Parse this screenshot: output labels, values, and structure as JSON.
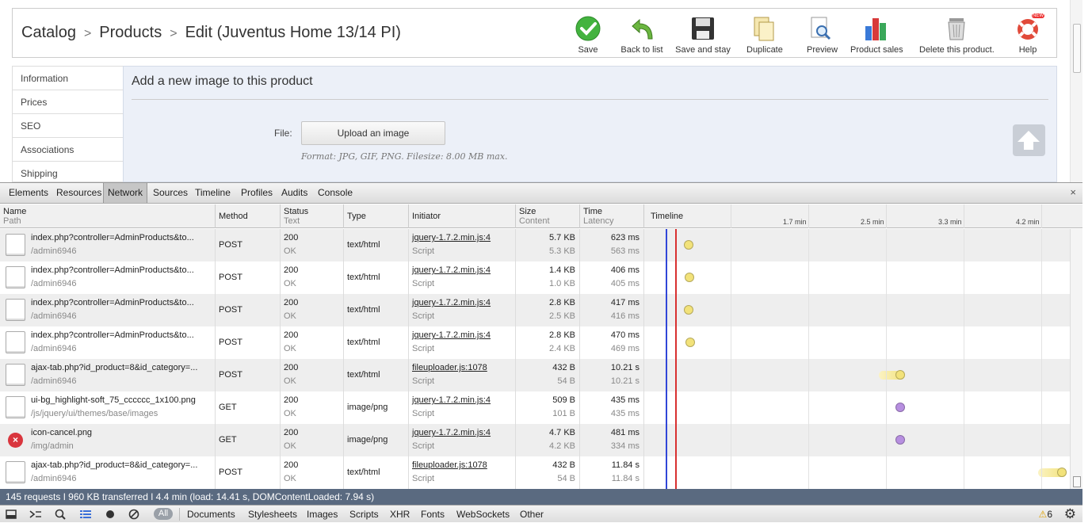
{
  "breadcrumb": {
    "catalog": "Catalog",
    "products": "Products",
    "current": "Edit (Juventus Home 13/14 PI)",
    "separator": ">"
  },
  "toolbar": {
    "save": "Save",
    "back": "Back to list",
    "save_stay": "Save and stay",
    "duplicate": "Duplicate",
    "preview": "Preview",
    "product_sales": "Product sales",
    "delete": "Delete this product.",
    "help": "Help",
    "help_badge": "NEW"
  },
  "sidebar": [
    "Information",
    "Prices",
    "SEO",
    "Associations",
    "Shipping"
  ],
  "content": {
    "title": "Add a new image to this product",
    "file_label": "File:",
    "upload_button": "Upload an image",
    "format_note": "Format: JPG, GIF, PNG. Filesize: 8.00 MB max."
  },
  "devtools": {
    "tabs": [
      "Elements",
      "Resources",
      "Network",
      "Sources",
      "Timeline",
      "Profiles",
      "Audits",
      "Console"
    ],
    "active_tab": "Network",
    "close": "×",
    "columns": {
      "name": "Name",
      "path": "Path",
      "method": "Method",
      "status": "Status",
      "text": "Text",
      "type": "Type",
      "initiator": "Initiator",
      "size": "Size",
      "content": "Content",
      "time": "Time",
      "latency": "Latency",
      "timeline": "Timeline"
    },
    "timeline_ticks": [
      "1.7 min",
      "2.5 min",
      "3.3 min",
      "4.2 min"
    ],
    "rows": [
      {
        "name": "index.php?controller=AdminProducts&to...",
        "path": "/admin6946",
        "method": "POST",
        "status": "200",
        "status_text": "OK",
        "type": "text/html",
        "initiator": "jquery-1.7.2.min.js:4",
        "initiator_type": "Script",
        "size": "5.7 KB",
        "content": "5.3 KB",
        "time": "623 ms",
        "latency": "563 ms",
        "icon": "document-icon",
        "bar_color": "#f2e27a"
      },
      {
        "name": "index.php?controller=AdminProducts&to...",
        "path": "/admin6946",
        "method": "POST",
        "status": "200",
        "status_text": "OK",
        "type": "text/html",
        "initiator": "jquery-1.7.2.min.js:4",
        "initiator_type": "Script",
        "size": "1.4 KB",
        "content": "1.0 KB",
        "time": "406 ms",
        "latency": "405 ms",
        "icon": "document-icon",
        "bar_color": "#f2e27a"
      },
      {
        "name": "index.php?controller=AdminProducts&to...",
        "path": "/admin6946",
        "method": "POST",
        "status": "200",
        "status_text": "OK",
        "type": "text/html",
        "initiator": "jquery-1.7.2.min.js:4",
        "initiator_type": "Script",
        "size": "2.8 KB",
        "content": "2.5 KB",
        "time": "417 ms",
        "latency": "416 ms",
        "icon": "document-icon",
        "bar_color": "#f2e27a"
      },
      {
        "name": "index.php?controller=AdminProducts&to...",
        "path": "/admin6946",
        "method": "POST",
        "status": "200",
        "status_text": "OK",
        "type": "text/html",
        "initiator": "jquery-1.7.2.min.js:4",
        "initiator_type": "Script",
        "size": "2.8 KB",
        "content": "2.4 KB",
        "time": "470 ms",
        "latency": "469 ms",
        "icon": "document-icon",
        "bar_color": "#f2e27a"
      },
      {
        "name": "ajax-tab.php?id_product=8&id_category=...",
        "path": "/admin6946",
        "method": "POST",
        "status": "200",
        "status_text": "OK",
        "type": "text/html",
        "initiator": "fileuploader.js:1078",
        "initiator_type": "Script",
        "size": "432 B",
        "content": "54 B",
        "time": "10.21 s",
        "latency": "10.21 s",
        "icon": "document-icon",
        "bar_color": "#f2e27a"
      },
      {
        "name": "ui-bg_highlight-soft_75_cccccc_1x100.png",
        "path": "/js/jquery/ui/themes/base/images",
        "method": "GET",
        "status": "200",
        "status_text": "OK",
        "type": "image/png",
        "initiator": "jquery-1.7.2.min.js:4",
        "initiator_type": "Script",
        "size": "509 B",
        "content": "101 B",
        "time": "435 ms",
        "latency": "435 ms",
        "icon": "image-icon",
        "bar_color": "#b78fe0"
      },
      {
        "name": "icon-cancel.png",
        "path": "/img/admin",
        "method": "GET",
        "status": "200",
        "status_text": "OK",
        "type": "image/png",
        "initiator": "jquery-1.7.2.min.js:4",
        "initiator_type": "Script",
        "size": "4.7 KB",
        "content": "4.2 KB",
        "time": "481 ms",
        "latency": "334 ms",
        "icon": "cancel-icon",
        "bar_color": "#b78fe0"
      },
      {
        "name": "ajax-tab.php?id_product=8&id_category=...",
        "path": "/admin6946",
        "method": "POST",
        "status": "200",
        "status_text": "OK",
        "type": "text/html",
        "initiator": "fileuploader.js:1078",
        "initiator_type": "Script",
        "size": "432 B",
        "content": "54 B",
        "time": "11.84 s",
        "latency": "11.84 s",
        "icon": "document-icon",
        "bar_color": "#f2e27a"
      }
    ],
    "status_bar": "145 requests  ǀ  960 KB transferred  ǀ  4.4 min (load: 14.41 s, DOMContentLoaded: 7.94 s)",
    "filters": {
      "all": "All",
      "items": [
        "Documents",
        "Stylesheets",
        "Images",
        "Scripts",
        "XHR",
        "Fonts",
        "WebSockets",
        "Other"
      ]
    },
    "warnings": "6",
    "colors": {
      "status_bar": "#5a6a80",
      "load_line": "#d83030",
      "dom_line": "#3046d8"
    }
  }
}
